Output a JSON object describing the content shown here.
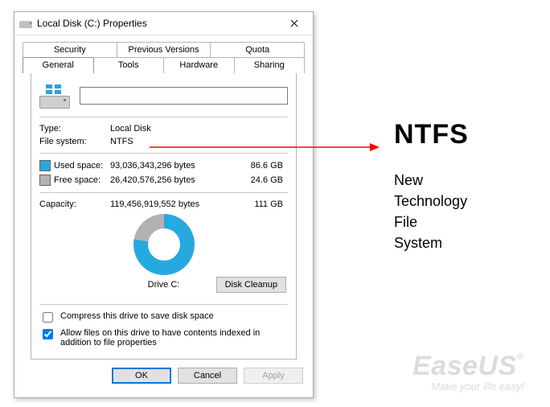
{
  "window_title": "Local Disk (C:) Properties",
  "tabs_row1": [
    "Security",
    "Previous Versions",
    "Quota"
  ],
  "tabs_row2": [
    "General",
    "Tools",
    "Hardware",
    "Sharing"
  ],
  "active_tab": "General",
  "name_value": "",
  "type_label": "Type:",
  "type_value": "Local Disk",
  "fs_label": "File system:",
  "fs_value": "NTFS",
  "used_label": "Used space:",
  "used_bytes": "93,036,343,296 bytes",
  "used_gb": "86.6 GB",
  "free_label": "Free space:",
  "free_bytes": "26,420,576,256 bytes",
  "free_gb": "24.6 GB",
  "capacity_label": "Capacity:",
  "capacity_bytes": "119,456,919,552 bytes",
  "capacity_gb": "111 GB",
  "drive_caption": "Drive C:",
  "cleanup_label": "Disk Cleanup",
  "compress_label": "Compress this drive to save disk space",
  "compress_checked": false,
  "index_label": "Allow files on this drive to have contents indexed in addition to file properties",
  "index_checked": true,
  "ok_label": "OK",
  "cancel_label": "Cancel",
  "apply_label": "Apply",
  "callout": {
    "title": "NTFS",
    "lines": [
      "New",
      "Technology",
      "File",
      "System"
    ]
  },
  "watermark": {
    "brand": "EaseUS",
    "tagline": "Make your life easy!"
  }
}
